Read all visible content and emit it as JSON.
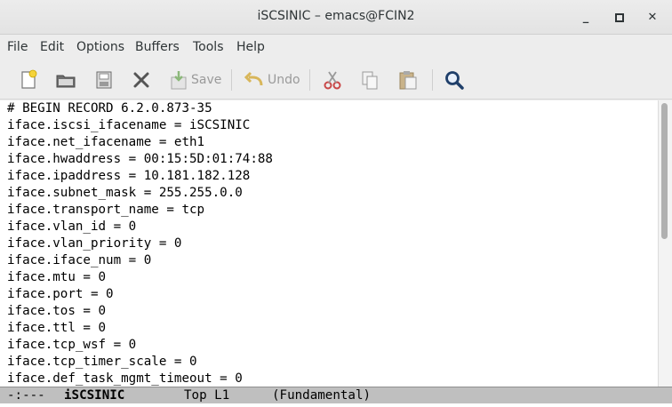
{
  "window": {
    "title": "iSCSINIC – emacs@FCIN2",
    "minimize_icon": "minimize-icon",
    "maximize_icon": "maximize-icon",
    "close_icon": "close-icon"
  },
  "menubar": {
    "items": [
      "File",
      "Edit",
      "Options",
      "Buffers",
      "Tools",
      "Help"
    ]
  },
  "toolbar": {
    "buttons": [
      {
        "icon": "new-file-icon",
        "label": ""
      },
      {
        "icon": "open-folder-icon",
        "label": ""
      },
      {
        "icon": "save-disk-icon",
        "label": ""
      },
      {
        "icon": "close-x-icon",
        "label": ""
      },
      {
        "icon": "save-icon",
        "label": "Save"
      },
      {
        "icon": "undo-icon",
        "label": "Undo"
      },
      {
        "icon": "cut-icon",
        "label": ""
      },
      {
        "icon": "copy-icon",
        "label": ""
      },
      {
        "icon": "paste-icon",
        "label": ""
      },
      {
        "icon": "search-icon",
        "label": ""
      }
    ]
  },
  "buffer": {
    "lines": [
      "# BEGIN RECORD 6.2.0.873-35",
      "iface.iscsi_ifacename = iSCSINIC",
      "iface.net_ifacename = eth1",
      "iface.hwaddress = 00:15:5D:01:74:88",
      "iface.ipaddress = 10.181.182.128",
      "iface.subnet_mask = 255.255.0.0",
      "iface.transport_name = tcp",
      "iface.vlan_id = 0",
      "iface.vlan_priority = 0",
      "iface.iface_num = 0",
      "iface.mtu = 0",
      "iface.port = 0",
      "iface.tos = 0",
      "iface.ttl = 0",
      "iface.tcp_wsf = 0",
      "iface.tcp_timer_scale = 0",
      "iface.def_task_mgmt_timeout = 0"
    ]
  },
  "modeline": {
    "status": "-:---",
    "buffer_name": "iSCSINIC",
    "position": "Top L1",
    "mode": "(Fundamental)"
  },
  "colors": {
    "modeline_bg": "#bfbfbf",
    "editor_bg": "#ffffff",
    "chrome_bg": "#ededed"
  }
}
